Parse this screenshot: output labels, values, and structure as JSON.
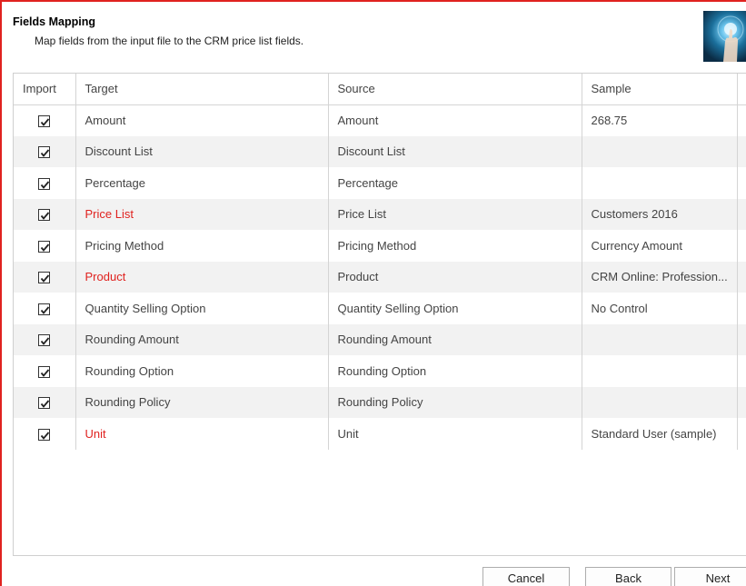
{
  "header": {
    "title": "Fields Mapping",
    "subtitle": "Map fields from the input file to the CRM price list fields."
  },
  "columns": [
    "Import",
    "Target",
    "Source",
    "Sample"
  ],
  "rows": [
    {
      "import": true,
      "target": "Amount",
      "source": "Amount",
      "sample": "268.75",
      "required": false
    },
    {
      "import": true,
      "target": "Discount List",
      "source": "Discount List",
      "sample": "",
      "required": false
    },
    {
      "import": true,
      "target": "Percentage",
      "source": "Percentage",
      "sample": "",
      "required": false
    },
    {
      "import": true,
      "target": "Price List",
      "source": "Price List",
      "sample": "Customers 2016",
      "required": true
    },
    {
      "import": true,
      "target": "Pricing Method",
      "source": "Pricing Method",
      "sample": "Currency Amount",
      "required": false
    },
    {
      "import": true,
      "target": "Product",
      "source": "Product",
      "sample": "CRM Online: Profession...",
      "required": true
    },
    {
      "import": true,
      "target": "Quantity Selling Option",
      "source": "Quantity Selling Option",
      "sample": "No Control",
      "required": false
    },
    {
      "import": true,
      "target": "Rounding Amount",
      "source": "Rounding Amount",
      "sample": "",
      "required": false
    },
    {
      "import": true,
      "target": "Rounding Option",
      "source": "Rounding Option",
      "sample": "",
      "required": false
    },
    {
      "import": true,
      "target": "Rounding Policy",
      "source": "Rounding Policy",
      "sample": "",
      "required": false
    },
    {
      "import": true,
      "target": "Unit",
      "source": "Unit",
      "sample": "Standard User (sample)",
      "required": true
    }
  ],
  "buttons": {
    "cancel": "Cancel",
    "back": "Back",
    "next": "Next"
  },
  "colors": {
    "required_text": "#e0221f",
    "frame_border": "#e0221f",
    "alt_row": "#f2f2f2"
  },
  "icons": {
    "header_image": "crm-hand-touch-image",
    "checkbox": "checkmark-icon",
    "scroll_up": "scroll-up-icon",
    "scroll_down": "scroll-down-icon"
  }
}
